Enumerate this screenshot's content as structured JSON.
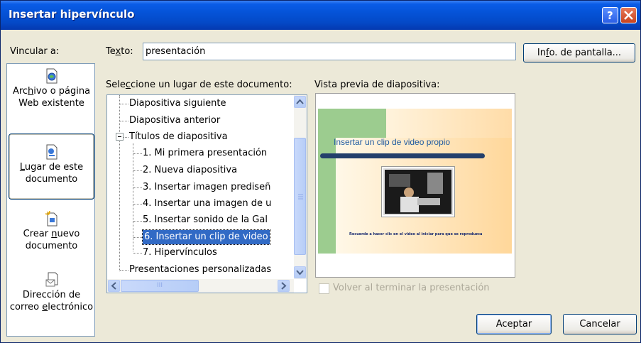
{
  "window": {
    "title": "Insertar hipervínculo"
  },
  "left": {
    "vincular_label": "Vincular a:",
    "items": [
      {
        "label_parts": [
          "Arc",
          "h",
          "ivo o página Web existente"
        ],
        "icon": "file-web-icon"
      },
      {
        "label_parts": [
          "",
          "L",
          "ugar de este documento"
        ],
        "icon": "document-place-icon"
      },
      {
        "label_parts": [
          "Crear ",
          "n",
          "uevo documento"
        ],
        "icon": "new-document-icon"
      },
      {
        "label_parts": [
          "Dirección de correo ",
          "e",
          "lectrónico"
        ],
        "icon": "email-address-icon"
      }
    ]
  },
  "texto": {
    "label_pre": "Te",
    "label_u": "x",
    "label_post": "to:",
    "value": "presentación"
  },
  "info_button": {
    "pre": "In",
    "u": "f",
    "post": "o. de pantalla..."
  },
  "tree": {
    "heading_pre": "Sele",
    "heading_u": "c",
    "heading_post": "cione un lugar de este documento:",
    "items": [
      {
        "label": "Diapositiva siguiente",
        "level": 1
      },
      {
        "label": "Diapositiva anterior",
        "level": 1
      },
      {
        "label": "Títulos de diapositiva",
        "level": 1,
        "expanded": true
      },
      {
        "label": "1. Mi primera presentación",
        "level": 2
      },
      {
        "label": "2. Nueva diapositiva",
        "level": 2
      },
      {
        "label": "3. Insertar imagen prediseñ",
        "level": 2
      },
      {
        "label": "4. Insertar una imagen de u",
        "level": 2
      },
      {
        "label": "5. Insertar sonido de la Gal",
        "level": 2
      },
      {
        "label": "6. Insertar un clip de video",
        "level": 2,
        "selected": true
      },
      {
        "label": "7. Hipervínculos",
        "level": 2
      },
      {
        "label": "Presentaciones personalizadas",
        "level": 1
      }
    ],
    "hscroll_grip": "III"
  },
  "preview": {
    "heading": "Vista previa de diapositiva:",
    "slide_title": "Insertar un clip de video propio",
    "slide_caption": "Recuerde a hacer clic en el video al iniciar para que se reproduzca",
    "checkbox_label": "Volver al terminar la presentación",
    "checkbox_checked": false
  },
  "buttons": {
    "ok": "Aceptar",
    "cancel": "Cancelar"
  },
  "colors": {
    "titlebar": "#0553d8",
    "selection": "#316ac5",
    "dialog": "#ece9d8"
  }
}
